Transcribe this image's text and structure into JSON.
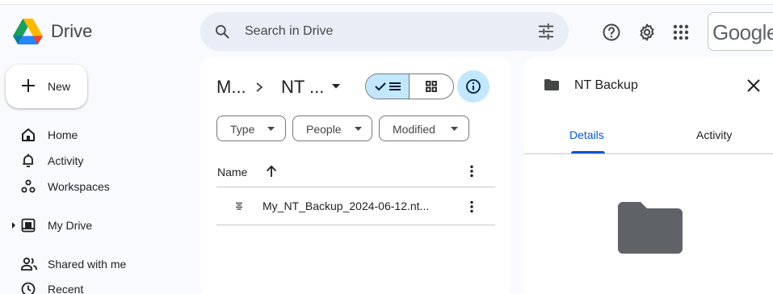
{
  "app": {
    "name": "Drive"
  },
  "search": {
    "placeholder": "Search in Drive"
  },
  "header": {
    "account_brand": "Google"
  },
  "sidebar": {
    "new_label": "New",
    "items": [
      {
        "label": "Home",
        "icon": "home-icon"
      },
      {
        "label": "Activity",
        "icon": "bell-icon"
      },
      {
        "label": "Workspaces",
        "icon": "workspaces-icon"
      },
      {
        "label": "My Drive",
        "icon": "drive-icon"
      },
      {
        "label": "Shared with me",
        "icon": "people-icon"
      },
      {
        "label": "Recent",
        "icon": "clock-icon"
      }
    ]
  },
  "main": {
    "breadcrumb": {
      "parent": "M...",
      "current": "NT ..."
    },
    "view": "list",
    "filters": [
      {
        "label": "Type"
      },
      {
        "label": "People"
      },
      {
        "label": "Modified"
      }
    ],
    "columns": {
      "name": "Name",
      "sort": "ascending"
    },
    "files": [
      {
        "name": "My_NT_Backup_2024-06-12.nt...",
        "icon": "text-file-icon"
      }
    ]
  },
  "details": {
    "title": "NT Backup",
    "tabs": [
      {
        "label": "Details",
        "active": true
      },
      {
        "label": "Activity",
        "active": false
      }
    ]
  },
  "colors": {
    "accent": "#0b57d0",
    "selected": "#c2e7ff",
    "background": "#f8fafd"
  }
}
